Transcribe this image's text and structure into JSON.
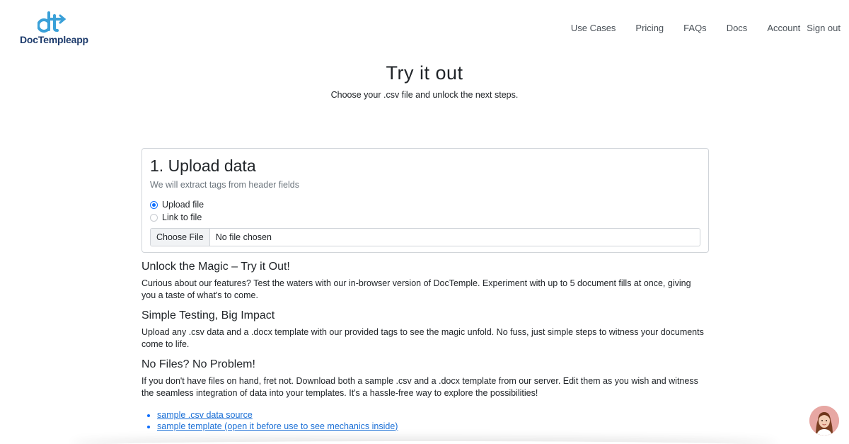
{
  "brand": {
    "name": "DocTempleapp",
    "accent_color": "#1d3b6c",
    "mark_color": "#3aa0d8"
  },
  "nav": {
    "items": [
      {
        "label": "Use Cases"
      },
      {
        "label": "Pricing"
      },
      {
        "label": "FAQs"
      },
      {
        "label": "Docs"
      },
      {
        "label": "Account"
      }
    ],
    "signout_label": "Sign out"
  },
  "hero": {
    "title": "Try it out",
    "subtitle": "Choose your .csv file and unlock the next steps."
  },
  "upload_card": {
    "title": "1. Upload data",
    "subtitle": "We will extract tags from header fields",
    "options": [
      {
        "label": "Upload file",
        "selected": true
      },
      {
        "label": "Link to file",
        "selected": false
      }
    ],
    "file_button_label": "Choose File",
    "file_status": "No file chosen",
    "radio_color": "#0d6efd"
  },
  "sections": [
    {
      "title": "Unlock the Magic – Try it Out!",
      "body": "Curious about our features? Test the waters with our in-browser version of DocTemple. Experiment with up to 5 document fills at once, giving you a taste of what's to come."
    },
    {
      "title": "Simple Testing, Big Impact",
      "body": "Upload any .csv data and a .docx template with our provided tags to see the magic unfold. No fuss, just simple steps to witness your documents come to life."
    },
    {
      "title": "No Files? No Problem!",
      "body": "If you don't have files on hand, fret not. Download both a sample .csv and a .docx template from our server. Edit them as you wish and witness the seamless integration of data into your templates. It's a hassle-free way to explore the possibilities!"
    }
  ],
  "links": [
    {
      "label": "sample .csv data source"
    },
    {
      "label": "sample template (open it before use to see mechanics inside)"
    }
  ],
  "link_color": "#1a6fd6",
  "avatar": {
    "icon": "support-agent-avatar"
  }
}
